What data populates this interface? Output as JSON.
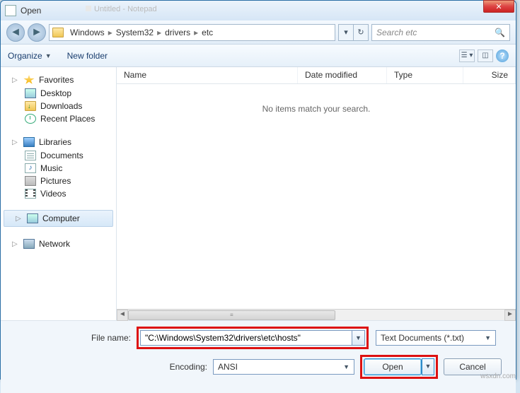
{
  "window": {
    "title": "Open"
  },
  "ghost_window": {
    "t1": "Untitled",
    "t2": "Notepad"
  },
  "breadcrumb": {
    "seg1": "Windows",
    "seg2": "System32",
    "seg3": "drivers",
    "seg4": "etc"
  },
  "search": {
    "placeholder": "Search etc"
  },
  "toolbar": {
    "organize": "Organize",
    "new_folder": "New folder"
  },
  "columns": {
    "name": "Name",
    "date": "Date modified",
    "type": "Type",
    "size": "Size"
  },
  "empty": "No items match your search.",
  "sidebar": {
    "favorites": "Favorites",
    "desktop": "Desktop",
    "downloads": "Downloads",
    "recent": "Recent Places",
    "libraries": "Libraries",
    "documents": "Documents",
    "music": "Music",
    "pictures": "Pictures",
    "videos": "Videos",
    "computer": "Computer",
    "network": "Network"
  },
  "bottom": {
    "filename_label": "File name:",
    "filename_value": "\"C:\\Windows\\System32\\drivers\\etc\\hosts\"",
    "filter_value": "Text Documents (*.txt)",
    "encoding_label": "Encoding:",
    "encoding_value": "ANSI",
    "open": "Open",
    "cancel": "Cancel"
  },
  "watermark": "wsxdn.com"
}
